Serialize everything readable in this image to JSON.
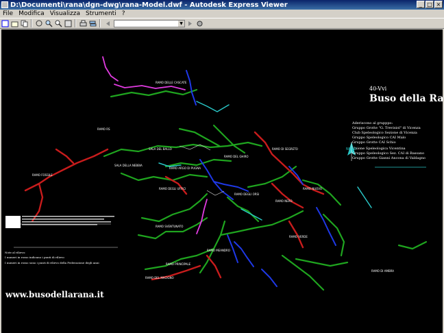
{
  "window": {
    "title": "D:\\Documenti\\rana\\dgn-dwg\\rana-Model.dwf - Autodesk Express Viewer"
  },
  "menu": [
    "File",
    "Modifica",
    "Visualizza",
    "Strumenti",
    "?"
  ],
  "drawing": {
    "sheet_number": "40-Vvi",
    "cave_name": "Buso della Rana",
    "credits_heading": "Aderiscono al grupppo:",
    "credits": [
      "Gruppo Grotte \"G. Trevisiol\" di Vicenza",
      "Club Speleologico Sezione di Vicenza",
      "Gruppo Speleologico CAI Malo",
      "Gruppo Grotte CAI Schio",
      "Unione Speleologica Vicentina",
      "Gruppo Speleologico Sez. CAI di Bassano",
      "Gruppo Grotte Gianni Ancona di Valdagno"
    ],
    "north_label": "NORD",
    "website": "www.busodellarana.it",
    "notes_title": "Note al rilievo:",
    "notes_line": "I numeri in rosso indicano i punti di rilievo",
    "footer_line": "I numeri in rosso sono i punti di rilievo della Federazione degli anni"
  },
  "labels": [
    "RAMO RS",
    "SALA DEL BALLO",
    "RAMO DI SEGRETO",
    "SALA DELLA NEBBIA",
    "RAMO ARGO DI PUGNA",
    "RAMO DEL GHIRO",
    "RAMO DEGLI UFFICI",
    "RAMO NERO",
    "RAMO DEGLI ORSI",
    "RAMO SVENTUNATO",
    "RAMO PRINCIPALE",
    "RAMO MEANDRO",
    "RAMO VERDE",
    "RAMO DEL MACIGNO",
    "RAMO DI AMBRA",
    "RAMO FOSSILE",
    "RAMO NUOVO",
    "RAMO DELLE CASCATE"
  ],
  "colors": {
    "titlebar": "#0a246a",
    "canvas": "#000000",
    "green": "#1fa51f",
    "red": "#c81c1c",
    "blue": "#1e38e6",
    "magenta": "#e03be0",
    "cyan": "#29c6c6"
  }
}
